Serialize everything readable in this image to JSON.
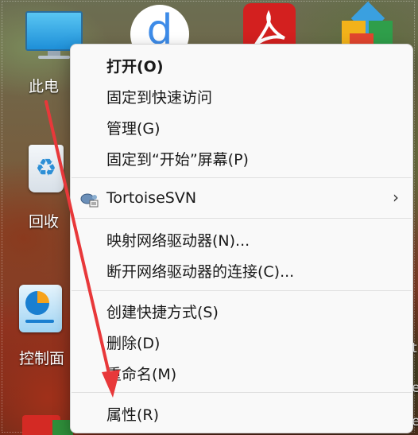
{
  "desktop": {
    "icons": {
      "this_pc": {
        "label": "此电",
        "icon": "monitor-icon"
      },
      "recycle_bin": {
        "label": "回收",
        "icon": "recycle-bin-icon"
      },
      "control_panel": {
        "label": "控制面",
        "icon": "control-panel-icon"
      },
      "app_d": {
        "glyph": "d",
        "icon": "app-d-icon"
      },
      "acrobat": {
        "icon": "acrobat-pdf-icon"
      },
      "colorful_app": {
        "icon": "colorful-app-icon"
      }
    },
    "right_edge_labels": [
      "t",
      "e",
      "e"
    ]
  },
  "context_menu": {
    "items": [
      {
        "label": "打开(O)",
        "bold": true
      },
      {
        "label": "固定到快速访问"
      },
      {
        "label": "管理(G)"
      },
      {
        "label": "固定到“开始”屏幕(P)"
      },
      {
        "label": "TortoiseSVN",
        "icon": "tortoise-svn-icon",
        "submenu_icon": "chevron-right-icon",
        "submenu_glyph": "›"
      },
      {
        "label": "映射网络驱动器(N)..."
      },
      {
        "label": "断开网络驱动器的连接(C)..."
      },
      {
        "label": "创建快捷方式(S)"
      },
      {
        "label": "删除(D)"
      },
      {
        "label": "重命名(M)"
      },
      {
        "label": "属性(R)"
      }
    ]
  },
  "colors": {
    "menu_background": "#f9f9f9",
    "annotation_arrow": "#e8383a"
  }
}
